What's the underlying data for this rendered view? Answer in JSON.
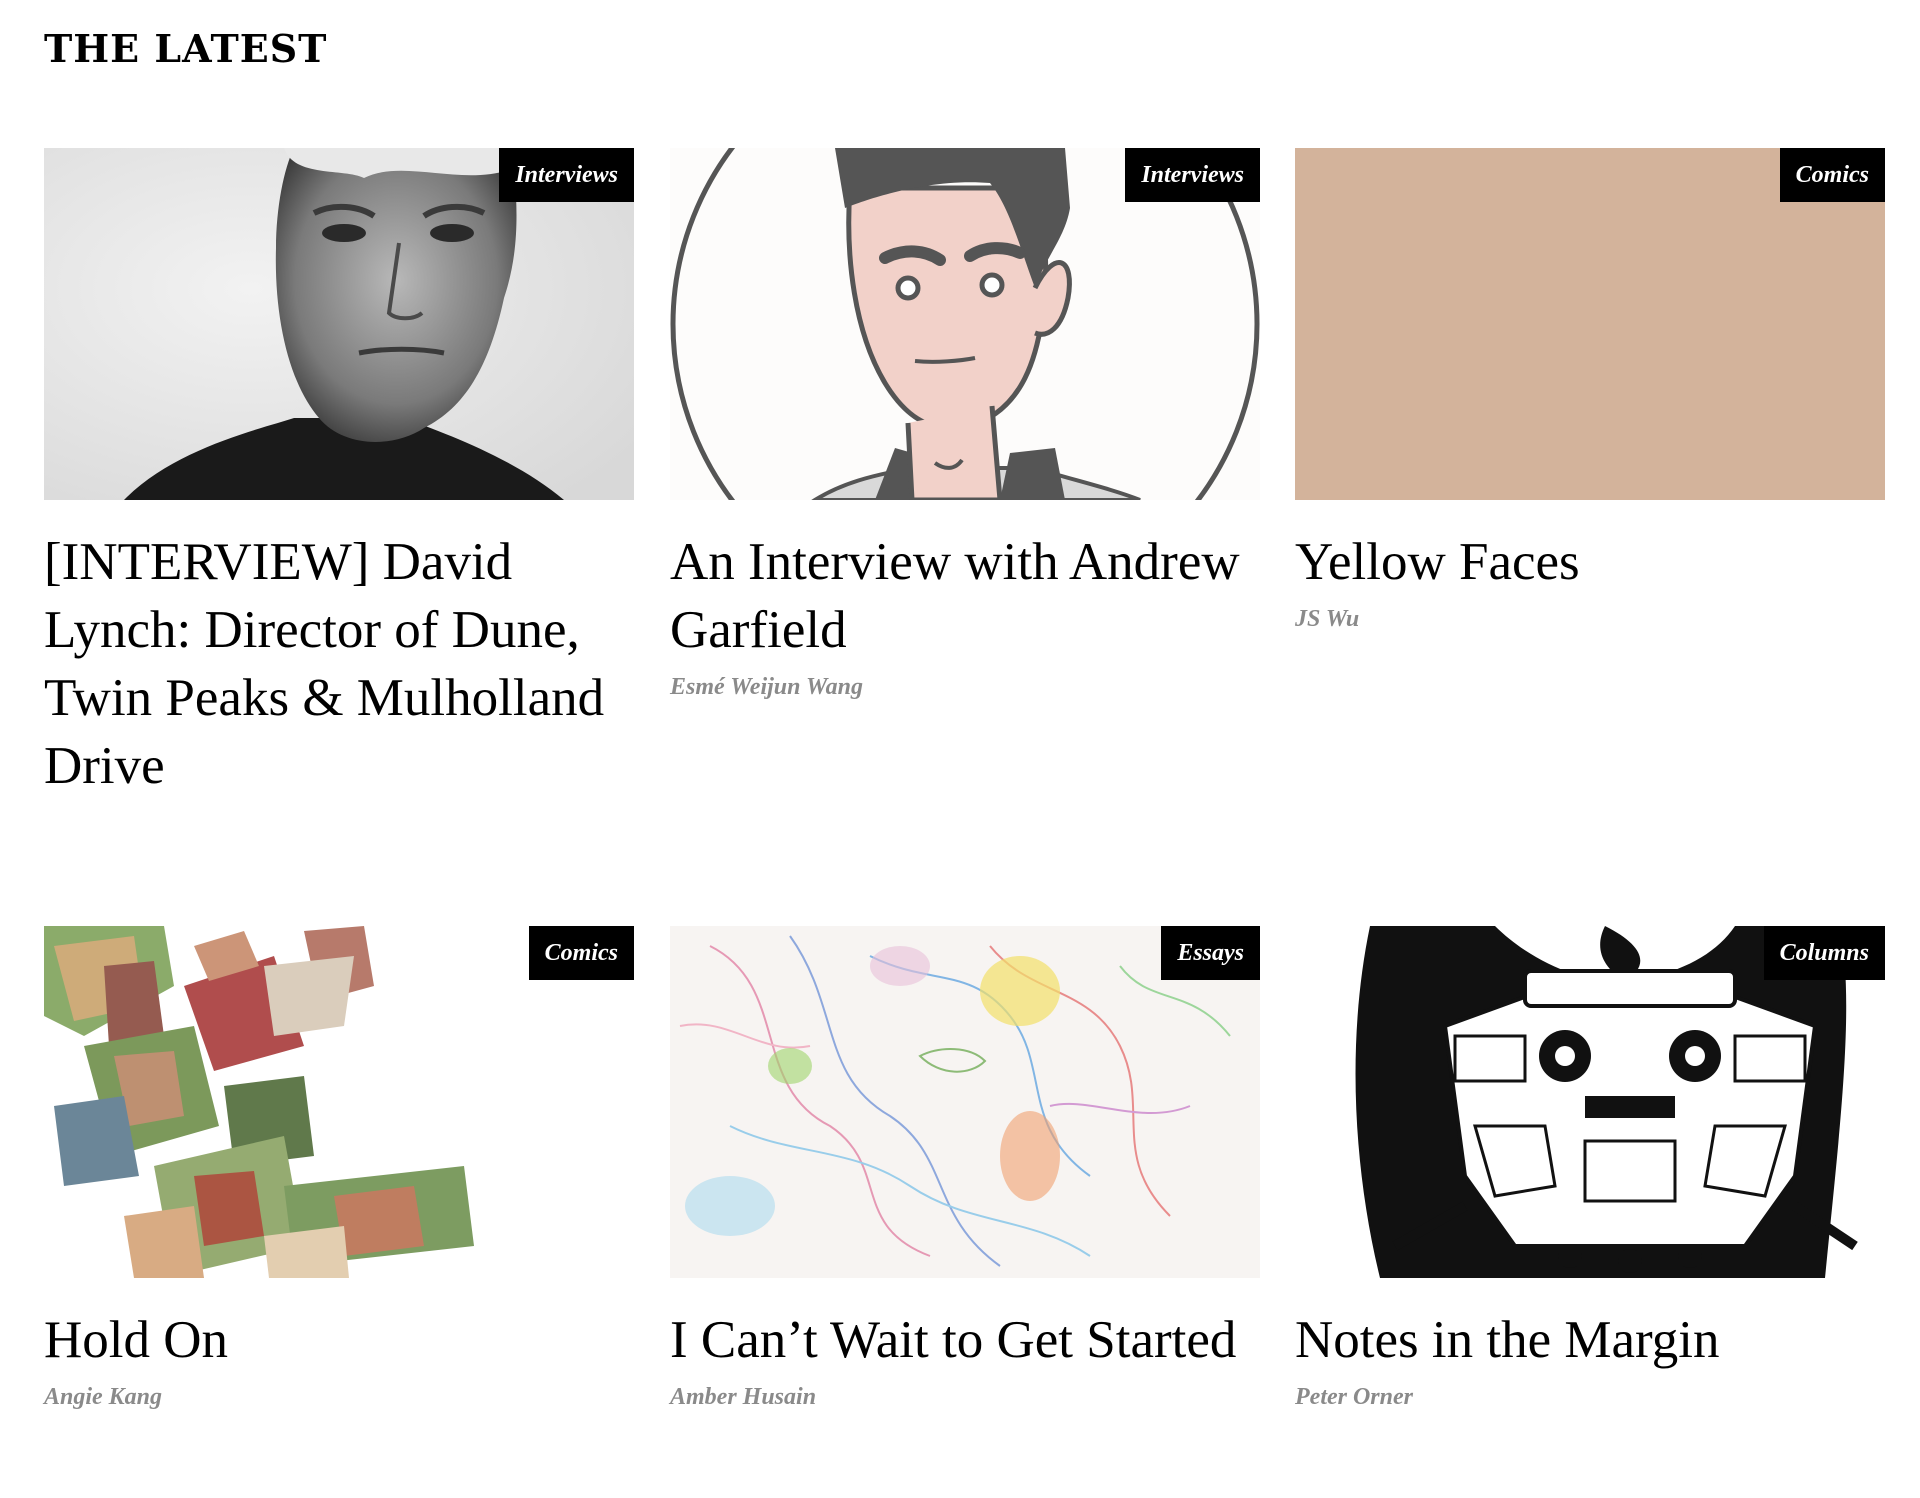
{
  "section": {
    "title": "THE LATEST"
  },
  "articles": [
    {
      "title": "[INTERVIEW] David Lynch: Director of Dune, Twin Peaks & Mulholland Drive",
      "category": "Interviews",
      "author": "",
      "image": "portrait-photo"
    },
    {
      "title": "An Interview with Andrew Garfield",
      "category": "Interviews",
      "author": "Esmé Weijun Wang",
      "image": "cartoon-portrait"
    },
    {
      "title": "Yellow Faces",
      "category": "Comics",
      "author": "JS Wu",
      "image": "solid-tan",
      "colors": {
        "fill": "#d3b39b"
      }
    },
    {
      "title": "Hold On",
      "category": "Comics",
      "author": "Angie Kang",
      "image": "watercolor-collage"
    },
    {
      "title": "I Can’t Wait to Get Started",
      "category": "Essays",
      "author": "Amber Husain",
      "image": "pastel-drawing"
    },
    {
      "title": "Notes in the Margin",
      "category": "Columns",
      "author": "Peter Orner",
      "image": "ink-illustration"
    }
  ]
}
